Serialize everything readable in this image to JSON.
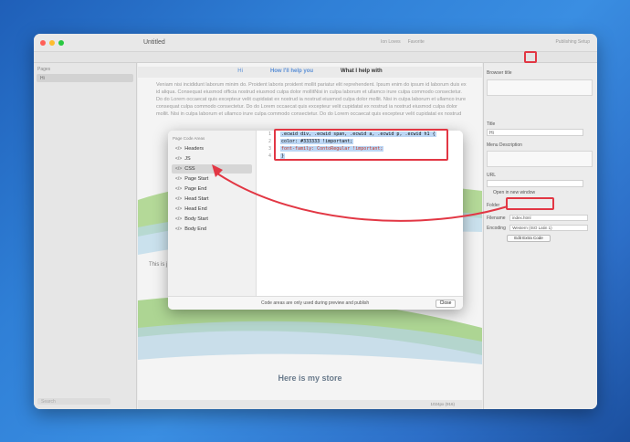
{
  "window": {
    "title": "Untitled",
    "toolbar_items": [
      "Ion Loves",
      "Favorite"
    ],
    "publish": "Publishing Setup"
  },
  "sidebar": {
    "header": "Pages",
    "page": "Hi",
    "search_placeholder": "Search"
  },
  "main": {
    "nav": [
      "Hi",
      "How I'll help you",
      "What I help with"
    ],
    "lorem": "Veniam nisi incididunt laborum minim do. Proident laboris proident mollit pariatur elit reprehendent. Ipsum enim do ipsum id laborum duis ex id aliqua. Consequat eiusmod officia nostrud eiusmod culpa dolor mollitNisi in culpa laborum et ullamco irure culpa commodo consectetur. Do do Lorem occaecat quis excepteur velit cupidatat ex nostrud ia nostrud eiusmod culpa dolor mollit. Nisi in culpa laborum et ullamco irure consequat culpa commodo consectetur. Do do Lorem occaecat quis excepteur velit cupidatat ex nostrud ia nostrud eiusmod culpa dolor mollit. Nisi in culpa laborum et ullamco irure culpa commodo consectetur. Do do Lorem occaecat quis excepteur velit cupidatat ex nostrud",
    "this_is": "This is j",
    "store_title": "Here is my store",
    "status": "1024px (916)"
  },
  "inspector": {
    "browser_title": "Browser title",
    "title_label": "Title",
    "title_value": "Hi",
    "menu_desc": "Menu Description",
    "url_label": "URL",
    "open_new": "Open in new window",
    "folder": "Folder",
    "filename_label": "Filename",
    "filename_value": "index.html",
    "encoding_label": "Encoding",
    "encoding_value": "Western (ISO Latin 1)",
    "extra_code": "Edit Extra Code"
  },
  "modal": {
    "header": "Page Code Areas",
    "items": [
      "Headers",
      "JS",
      "CSS",
      "Page Start",
      "Page End",
      "Head Start",
      "Head End",
      "Body Start",
      "Body End"
    ],
    "selected": "CSS",
    "code_lines": [
      {
        "n": "1",
        "text": ".ecwid div, .ecwid span, .ecwid a, .ecwid p, .ecwid h1 {"
      },
      {
        "n": "2",
        "text": "color: #333333 !important;"
      },
      {
        "n": "3",
        "text": "font-family: ContoRegular !important;"
      },
      {
        "n": "4",
        "text": "}"
      }
    ],
    "footer_note": "Code areas are only used during preview and publish",
    "close": "Close"
  },
  "colors": {
    "highlight": "#e23744",
    "selection": "#bcd7f5"
  }
}
